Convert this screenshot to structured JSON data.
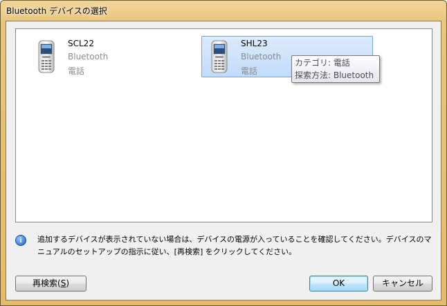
{
  "window": {
    "title": "Bluetooth デバイスの選択"
  },
  "devices": [
    {
      "name": "SCL22",
      "type": "Bluetooth",
      "category": "電話",
      "selected": false
    },
    {
      "name": "SHL23",
      "type": "Bluetooth",
      "category": "電話",
      "selected": true
    }
  ],
  "tooltip": {
    "line1": "カテゴリ: 電話",
    "line2": "探索方法: Bluetooth"
  },
  "info": {
    "text": "追加するデバイスが表示されていない場合は、デバイスの電源が入っていることを確認してください。デバイスのマニュアルのセットアップの指示に従い、[再検索] をクリックしてください。"
  },
  "buttons": {
    "rescan_prefix": "再検索(",
    "rescan_key": "S",
    "rescan_suffix": ")",
    "ok": "OK",
    "cancel": "キャンセル"
  },
  "colors": {
    "title_bar": "#e9c67c",
    "selection": "#c1dbfc",
    "selection_border": "#7da2ce"
  },
  "icons": [
    "phone-icon",
    "info-icon"
  ]
}
